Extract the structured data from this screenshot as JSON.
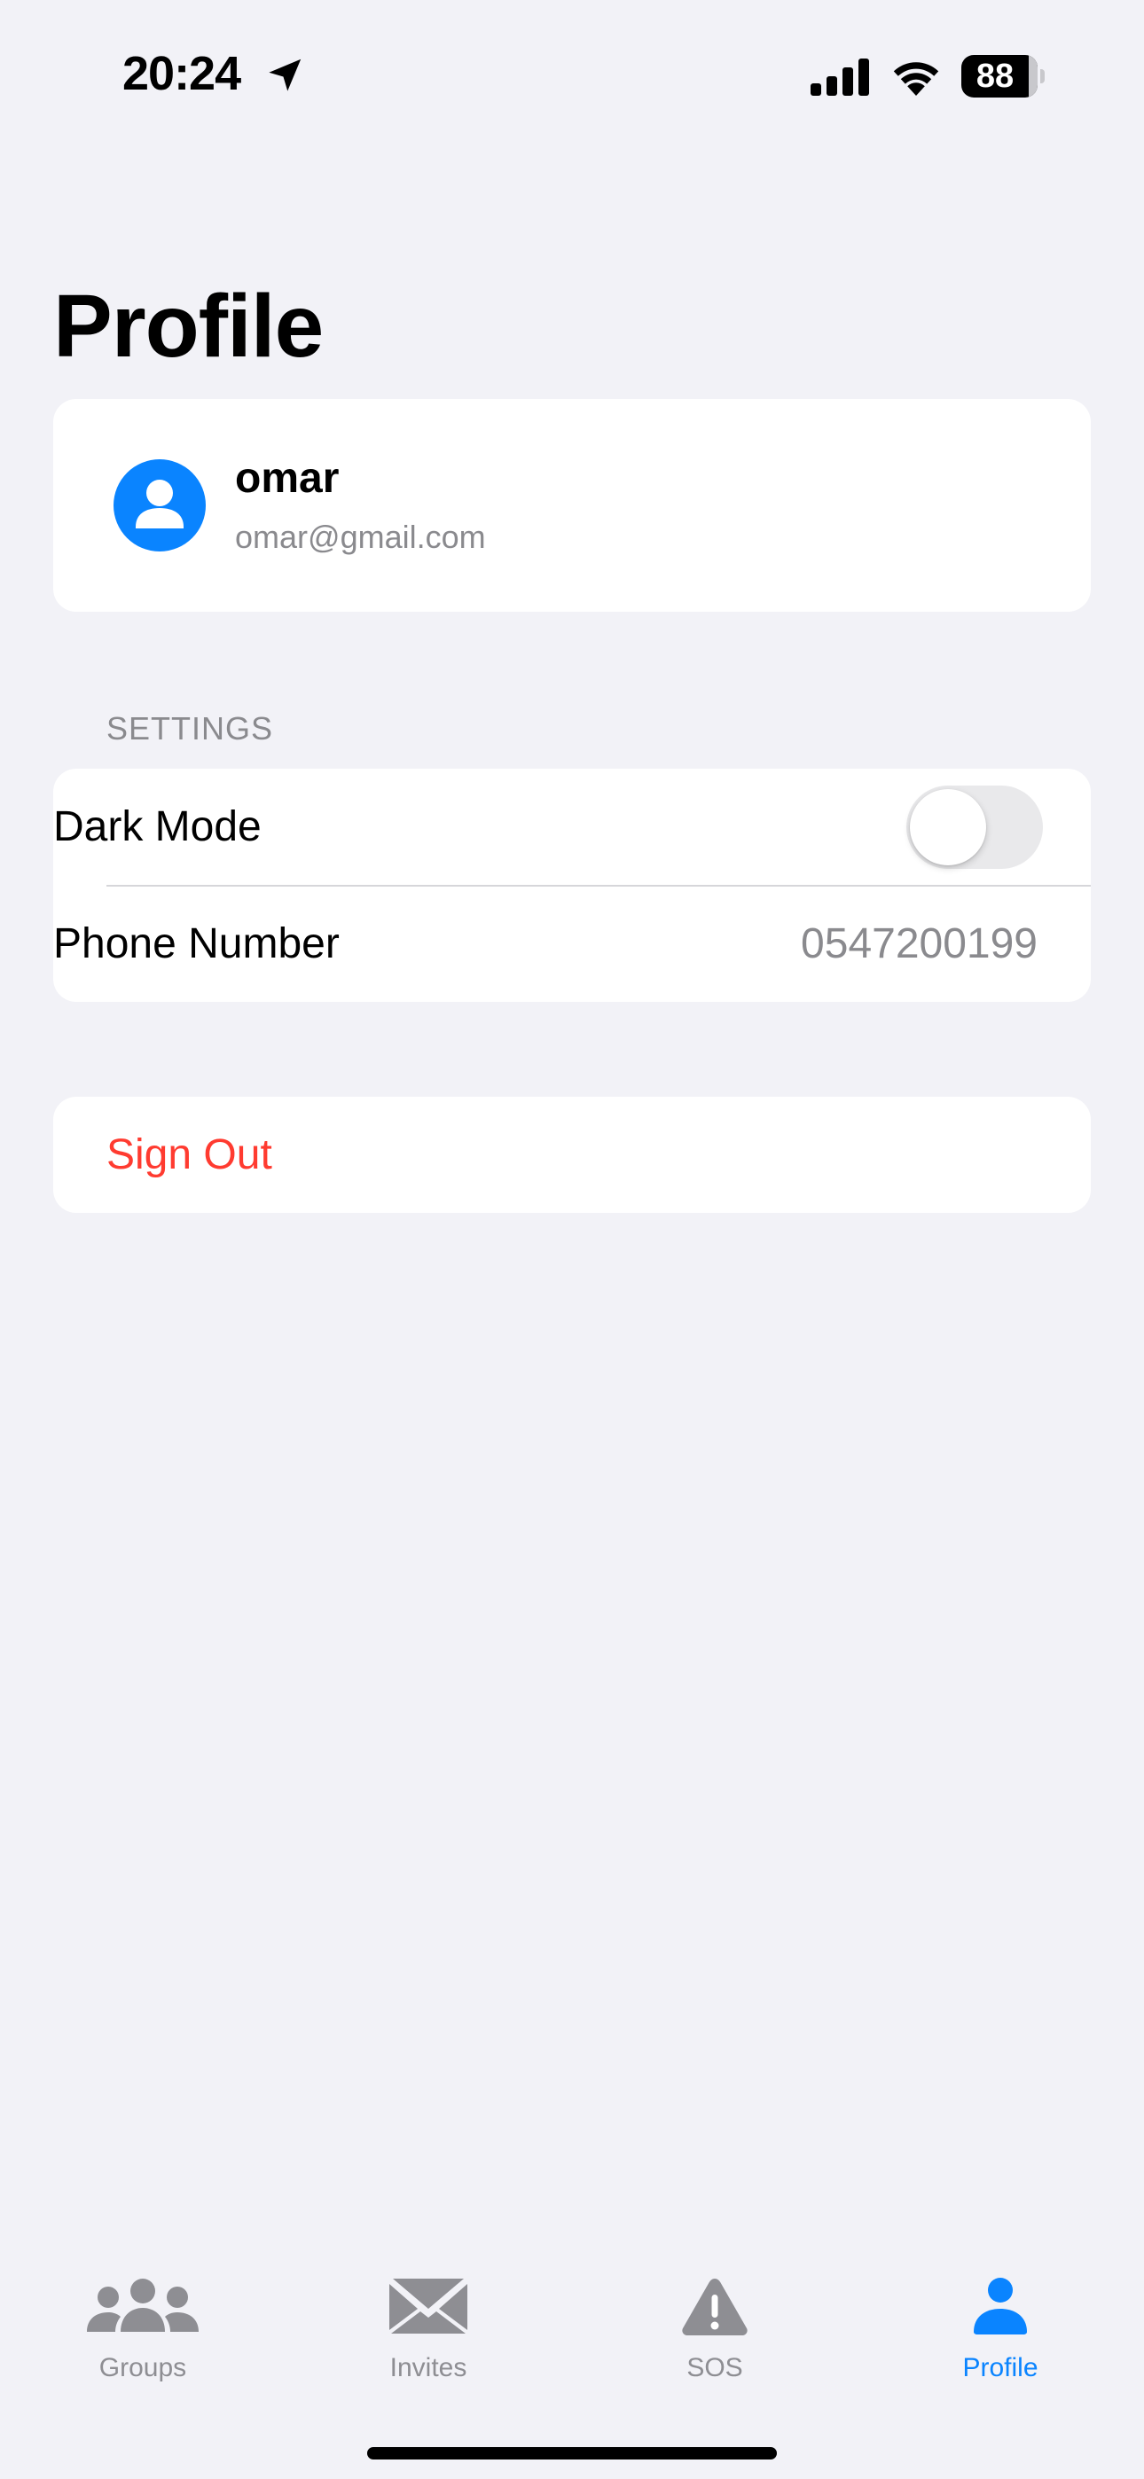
{
  "status_bar": {
    "time": "20:24",
    "battery_level": "88",
    "battery_fraction": 0.88,
    "icons": [
      "location-arrow-icon",
      "cellular-signal-icon",
      "wifi-icon",
      "battery-icon"
    ]
  },
  "page": {
    "title": "Profile"
  },
  "profile": {
    "name": "omar",
    "email": "omar@gmail.com",
    "avatar_icon": "person-icon",
    "avatar_color": "#0a84ff"
  },
  "settings": {
    "header": "SETTINGS",
    "dark_mode_label": "Dark Mode",
    "dark_mode_on": false,
    "phone_label": "Phone Number",
    "phone_value": "0547200199"
  },
  "actions": {
    "sign_out_label": "Sign Out",
    "sign_out_color": "#ff3b30"
  },
  "tab_bar": {
    "active_tab": "Profile",
    "active_color": "#0a84ff",
    "inactive_color": "#8e8e93",
    "tabs": [
      {
        "label": "Groups",
        "icon": "people-group-icon"
      },
      {
        "label": "Invites",
        "icon": "envelope-icon"
      },
      {
        "label": "SOS",
        "icon": "warning-triangle-icon"
      },
      {
        "label": "Profile",
        "icon": "person-icon"
      }
    ]
  }
}
